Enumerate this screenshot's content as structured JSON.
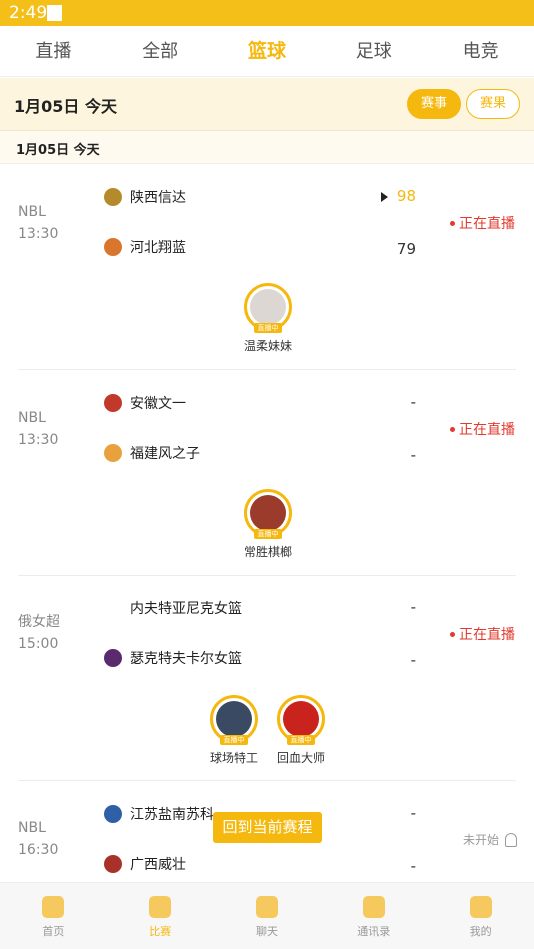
{
  "status": {
    "time": "2:49"
  },
  "tabs": [
    "直播",
    "全部",
    "篮球",
    "足球",
    "电竞"
  ],
  "date_bar": {
    "date": "1月05日  今天",
    "btn_events": "赛事",
    "btn_results": "赛果"
  },
  "sub_date": "1月05日    今天",
  "matches": [
    {
      "league": "NBL",
      "time": "13:30",
      "home": {
        "name": "陕西信达",
        "score": "98"
      },
      "away": {
        "name": "河北翔蓝",
        "score": "79"
      },
      "status": "正在直播",
      "anchors": [
        {
          "name": "温柔妹妹",
          "tag": "直播中"
        }
      ]
    },
    {
      "league": "NBL",
      "time": "13:30",
      "home": {
        "name": "安徽文一",
        "score": "-"
      },
      "away": {
        "name": "福建风之子",
        "score": "-"
      },
      "status": "正在直播",
      "anchors": [
        {
          "name": "常胜棋榔",
          "tag": "直播中"
        }
      ]
    },
    {
      "league": "俄女超",
      "time": "15:00",
      "home": {
        "name": "内夫特亚尼克女篮",
        "score": "-"
      },
      "away": {
        "name": "瑟克特夫卡尔女篮",
        "score": "-"
      },
      "status": "正在直播",
      "anchors": [
        {
          "name": "球场特工",
          "tag": "直播中"
        },
        {
          "name": "回血大师",
          "tag": "直播中"
        }
      ]
    },
    {
      "league": "NBL",
      "time": "16:30",
      "home": {
        "name": "江苏盐南苏科",
        "score": "-"
      },
      "away": {
        "name": "广西威壮",
        "score": "-"
      },
      "status": "未开始"
    }
  ],
  "back_button": "回到当前赛程",
  "bottom_nav": [
    "首页",
    "比赛",
    "聊天",
    "通讯录",
    "我的"
  ],
  "colors": {
    "accent": "#f5b80f",
    "live": "#e23a2e"
  }
}
